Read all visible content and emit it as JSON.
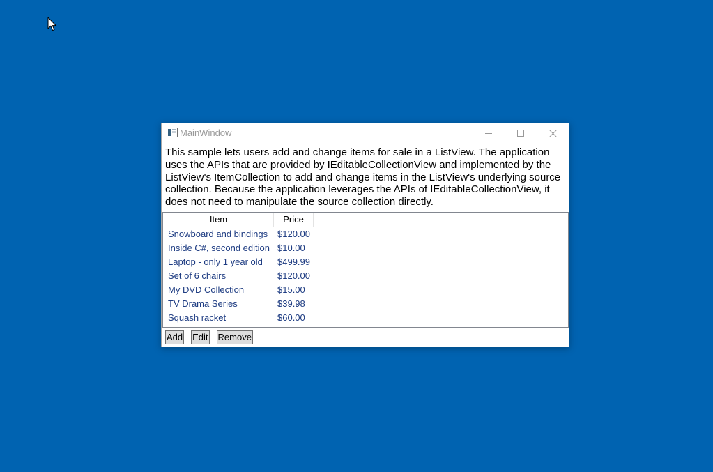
{
  "colors": {
    "desktop": "#0063B1",
    "title_text": "#999999",
    "item_text": "#1E3C82",
    "button_face": "#DDDDDD"
  },
  "window": {
    "title": "MainWindow",
    "icons": {
      "app": "window-app-icon",
      "minimize": "minimize-icon",
      "maximize": "maximize-icon",
      "close": "close-icon"
    }
  },
  "description": {
    "lines": [
      "This sample lets users add and change items for sale in a ListView. The application",
      "uses the APIs that are provided by IEditableCollectionView and implemented by the",
      "ListView's ItemCollection to add and change items in the ListView's underlying source",
      "collection. Because the application leverages the APIs of IEditableCollectionView, it",
      "does not need to manipulate the source collection directly."
    ]
  },
  "list_view": {
    "columns": [
      "Item",
      "Price"
    ],
    "rows": [
      {
        "item": "Snowboard and bindings",
        "price": "$120.00"
      },
      {
        "item": "Inside C#, second edition",
        "price": "$10.00"
      },
      {
        "item": "Laptop - only 1 year old",
        "price": "$499.99"
      },
      {
        "item": "Set of 6 chairs",
        "price": "$120.00"
      },
      {
        "item": "My DVD Collection",
        "price": "$15.00"
      },
      {
        "item": "TV Drama Series",
        "price": "$39.98"
      },
      {
        "item": "Squash racket",
        "price": "$60.00"
      }
    ]
  },
  "buttons": {
    "add": "Add",
    "edit": "Edit",
    "remove": "Remove"
  },
  "cursor": {
    "icon": "mouse-cursor-icon"
  }
}
